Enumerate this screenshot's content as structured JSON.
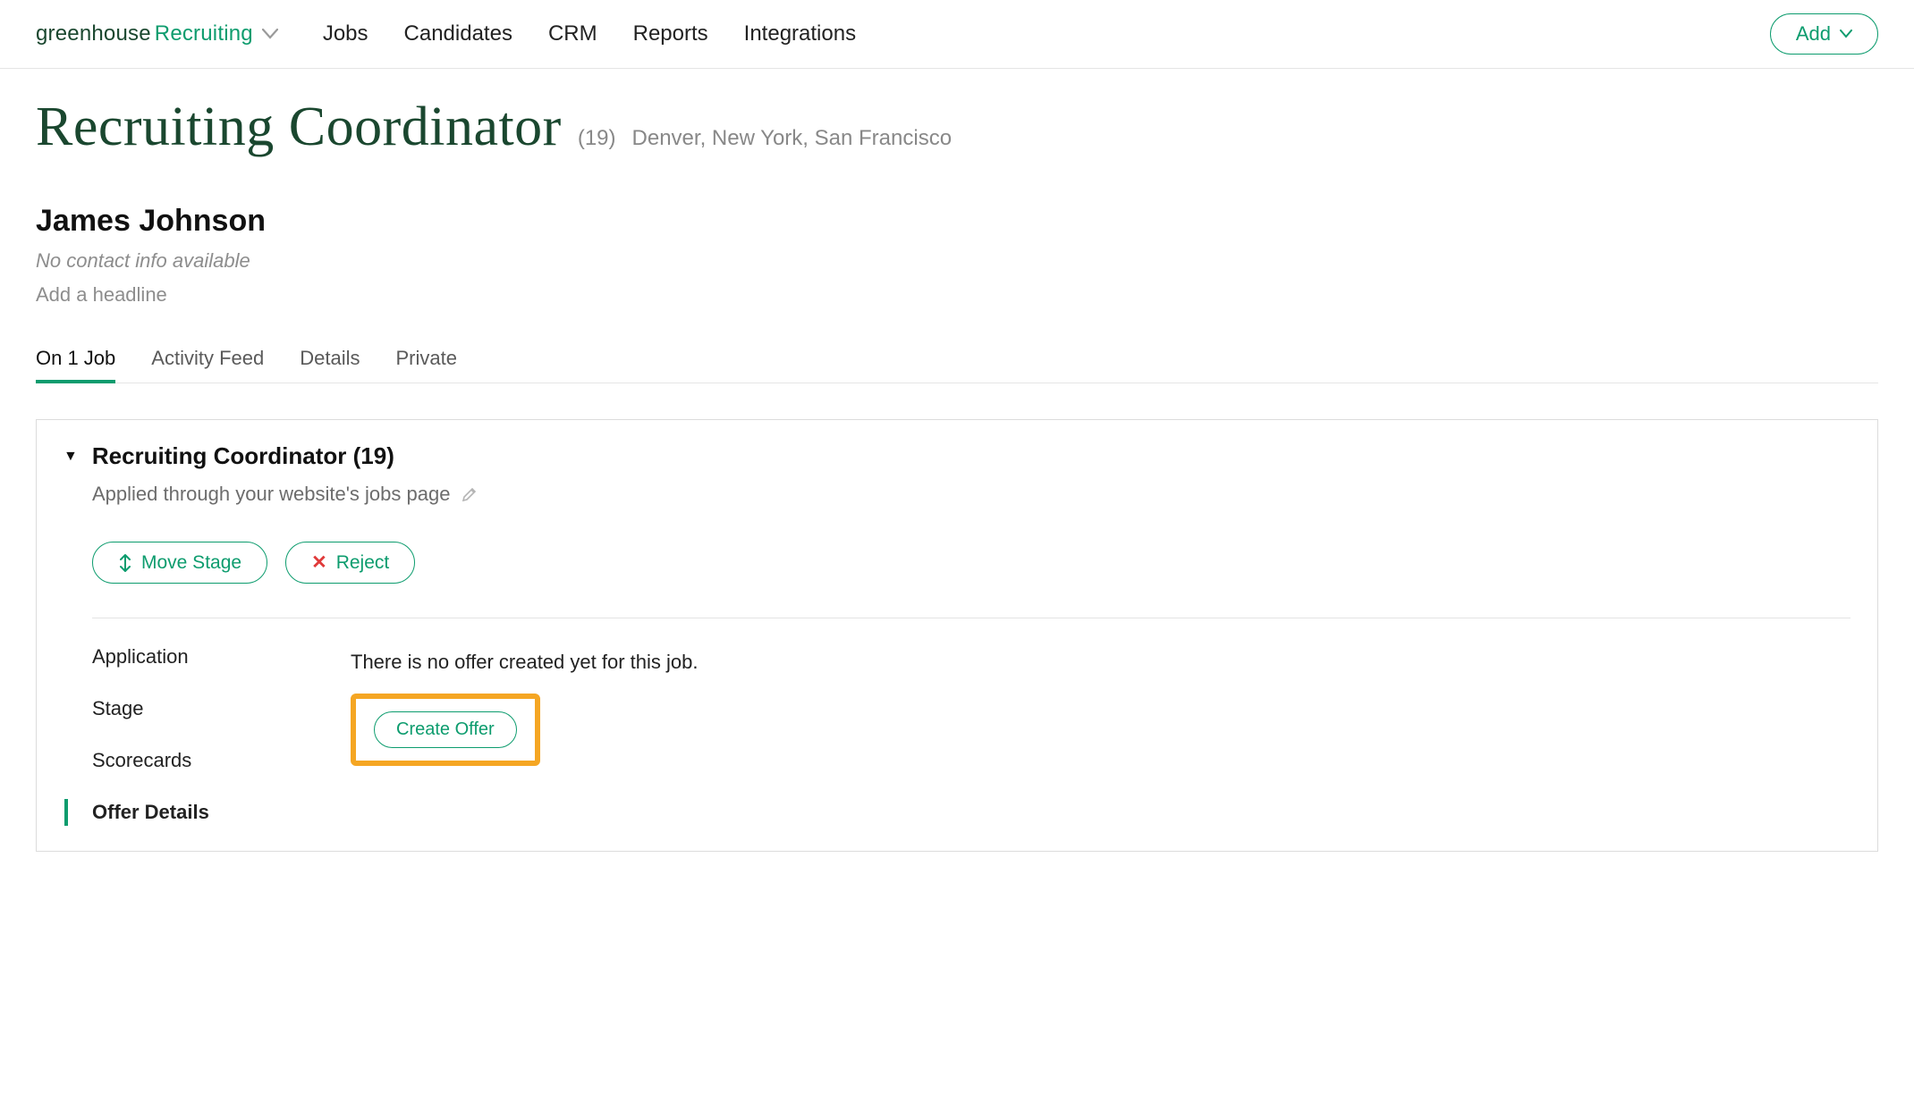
{
  "brand": {
    "g": "greenhouse",
    "r": "Recruiting"
  },
  "nav": {
    "items": [
      "Jobs",
      "Candidates",
      "CRM",
      "Reports",
      "Integrations"
    ],
    "add_label": "Add"
  },
  "job_header": {
    "title": "Recruiting Coordinator",
    "count": "(19)",
    "locations": "Denver, New York, San Francisco"
  },
  "candidate": {
    "name": "James Johnson",
    "no_contact": "No contact info available",
    "headline_prompt": "Add a headline",
    "tabs": [
      "On 1 Job",
      "Activity Feed",
      "Details",
      "Private"
    ]
  },
  "panel": {
    "job_name": "Recruiting Coordinator (19)",
    "applied_text": "Applied through your website's jobs page",
    "move_stage": "Move Stage",
    "reject": "Reject",
    "side": [
      "Application",
      "Stage",
      "Scorecards",
      "Offer Details"
    ],
    "no_offer": "There is no offer created yet for this job.",
    "create_offer": "Create Offer"
  }
}
